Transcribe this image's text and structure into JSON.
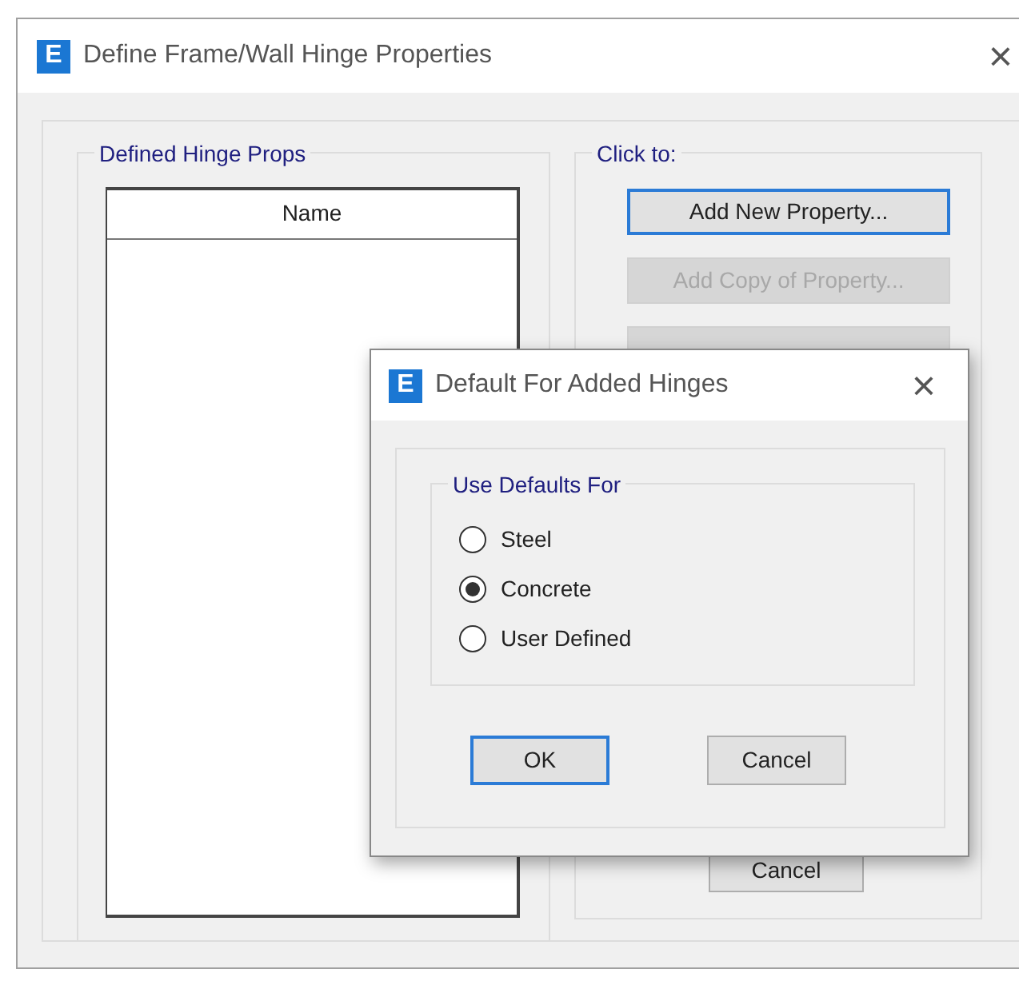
{
  "window": {
    "icon_text": "E",
    "title": "Define Frame/Wall Hinge Properties",
    "close": "×"
  },
  "defined_hinge_props": {
    "legend": "Defined Hinge Props",
    "columns": [
      "Name"
    ]
  },
  "click_to": {
    "legend": "Click to:",
    "buttons": [
      {
        "label": "Add New Property...",
        "disabled": false,
        "focused": true
      },
      {
        "label": "Add Copy of Property...",
        "disabled": true,
        "focused": false
      },
      {
        "disabled": true,
        "focused": false
      }
    ]
  },
  "cancel_button": "Cancel",
  "dialog": {
    "icon_text": "E",
    "title": "Default For Added Hinges",
    "close": "×",
    "legend": "Use Defaults For",
    "options": [
      {
        "label": "Steel",
        "selected": false
      },
      {
        "label": "Concrete",
        "selected": true
      },
      {
        "label": "User Defined",
        "selected": false
      }
    ],
    "buttons": [
      {
        "label": "OK",
        "focused": true
      },
      {
        "label": "Cancel",
        "focused": false
      }
    ]
  }
}
